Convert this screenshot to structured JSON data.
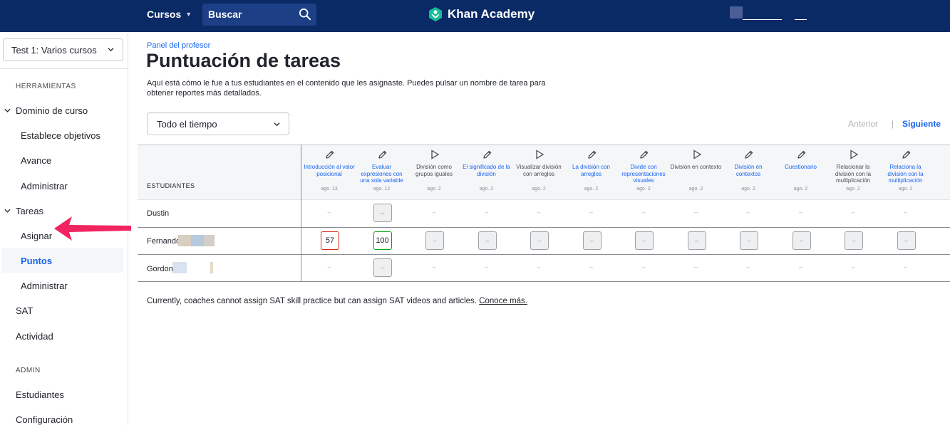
{
  "topbar": {
    "courses_label": "Cursos",
    "search_label": "Buscar",
    "brand": "Khan Academy",
    "colors": {
      "bg": "#0a2a66",
      "search_bg": "#1c3f85",
      "logo": "#14bf96"
    }
  },
  "sidebar": {
    "class_select": "Test 1: Varios cursos",
    "tools_heading": "HERRAMIENTAS",
    "mastery": "Dominio de curso",
    "set_goals": "Establece objetivos",
    "progress": "Avance",
    "manage1": "Administrar",
    "tasks": "Tareas",
    "assign": "Asignar",
    "points": "Puntos",
    "manage2": "Administrar",
    "sat": "SAT",
    "activity": "Actividad",
    "admin_heading": "ADMIN",
    "students": "Estudiantes",
    "settings": "Configuración",
    "annotation_arrow_color": "#f0245f"
  },
  "main": {
    "breadcrumb": "Panel del profesor",
    "title": "Puntuación de tareas",
    "description": "Aquí está cómo le fue a tus estudiantes en el contenido que les asignaste. Puedes pulsar un nombre de tarea para obtener reportes más detallados.",
    "range_select": "Todo el tiempo",
    "prev": "Anterior",
    "separator": "|",
    "next": "Siguiente",
    "students_header": "ESTUDIANTES",
    "footer_text": "Currently, coaches cannot assign SAT skill practice but can assign SAT videos and articles.",
    "footer_link": "Conoce más."
  },
  "assignments": [
    {
      "name": "Introducción al valor posicional",
      "date": "ago. 13",
      "icon": "pencil-icon",
      "link": true
    },
    {
      "name": "Evaluar expresiones con una sola variable",
      "date": "ago. 12",
      "icon": "pencil-icon",
      "link": true
    },
    {
      "name": "División como grupos iguales",
      "date": "ago. 2",
      "icon": "play-icon",
      "link": false
    },
    {
      "name": "El significado de la división",
      "date": "ago. 2",
      "icon": "pencil-icon",
      "link": true
    },
    {
      "name": "Visualizar división con arreglos",
      "date": "ago. 2",
      "icon": "play-icon",
      "link": false
    },
    {
      "name": "La división con arreglos",
      "date": "ago. 2",
      "icon": "pencil-icon",
      "link": true
    },
    {
      "name": "Divide con representaciones visuales",
      "date": "ago. 2",
      "icon": "pencil-icon",
      "link": true
    },
    {
      "name": "División en contexto",
      "date": "ago. 2",
      "icon": "play-icon",
      "link": false
    },
    {
      "name": "División en contextos",
      "date": "ago. 2",
      "icon": "pencil-icon",
      "link": true
    },
    {
      "name": "Cuestionario",
      "date": "ago. 2",
      "icon": "pencil-icon",
      "link": true
    },
    {
      "name": "Relacionar la división con la multiplicación",
      "date": "ago. 2",
      "icon": "play-icon",
      "link": false
    },
    {
      "name": "Relaciona la división con la multiplicación",
      "date": "ago. 2",
      "icon": "pencil-icon",
      "link": true
    }
  ],
  "rows": [
    {
      "student": "Dustin",
      "cells": [
        "–",
        "box:–",
        "–",
        "–",
        "–",
        "–",
        "–",
        "–",
        "–",
        "–",
        "–",
        "–"
      ]
    },
    {
      "student": "Fernando",
      "cells": [
        "score:57",
        "score:100",
        "box:–",
        "box:–",
        "box:–",
        "box:–",
        "box:–",
        "box:–",
        "box:–",
        "box:–",
        "box:–",
        "box:–"
      ]
    },
    {
      "student": "Gordon",
      "cells": [
        "–",
        "box:–",
        "–",
        "–",
        "–",
        "–",
        "–",
        "–",
        "–",
        "–",
        "–",
        "–"
      ]
    }
  ],
  "score_colors": {
    "low": "#d92916",
    "high": "#00a60e",
    "link": "#1865f2"
  }
}
